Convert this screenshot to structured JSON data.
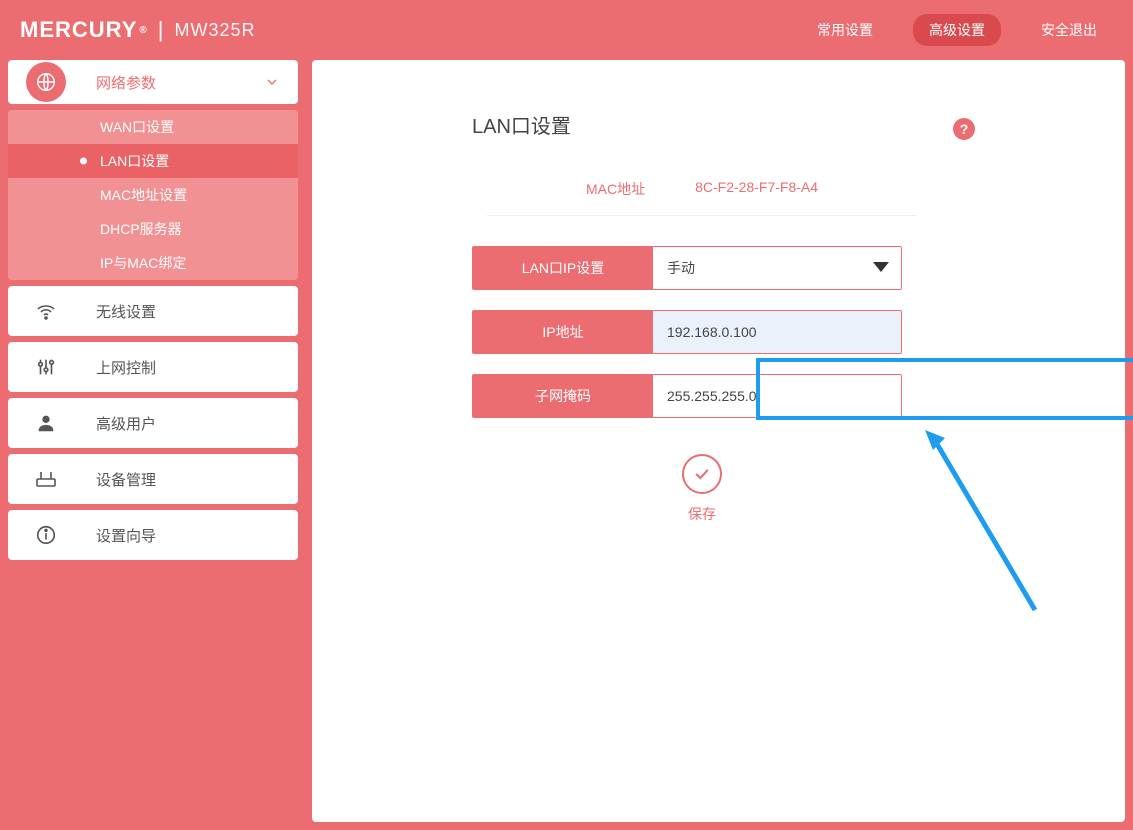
{
  "header": {
    "brand": "MERCURY",
    "model": "MW325R",
    "nav": {
      "common": "常用设置",
      "advanced": "高级设置",
      "logout": "安全退出"
    }
  },
  "sidebar": {
    "network": {
      "label": "网络参数",
      "children": {
        "wan": "WAN口设置",
        "lan": "LAN口设置",
        "mac": "MAC地址设置",
        "dhcp": "DHCP服务器",
        "ipmac": "IP与MAC绑定"
      }
    },
    "wireless": "无线设置",
    "control": "上网控制",
    "advancedUser": "高级用户",
    "device": "设备管理",
    "wizard": "设置向导"
  },
  "main": {
    "title": "LAN口设置",
    "mac": {
      "label": "MAC地址",
      "value": "8C-F2-28-F7-F8-A4"
    },
    "lanIpSetting": {
      "label": "LAN口IP设置",
      "value": "手动"
    },
    "ip": {
      "label": "IP地址",
      "value": "192.168.0.100"
    },
    "subnet": {
      "label": "子网掩码",
      "value": "255.255.255.0"
    },
    "save": "保存"
  }
}
